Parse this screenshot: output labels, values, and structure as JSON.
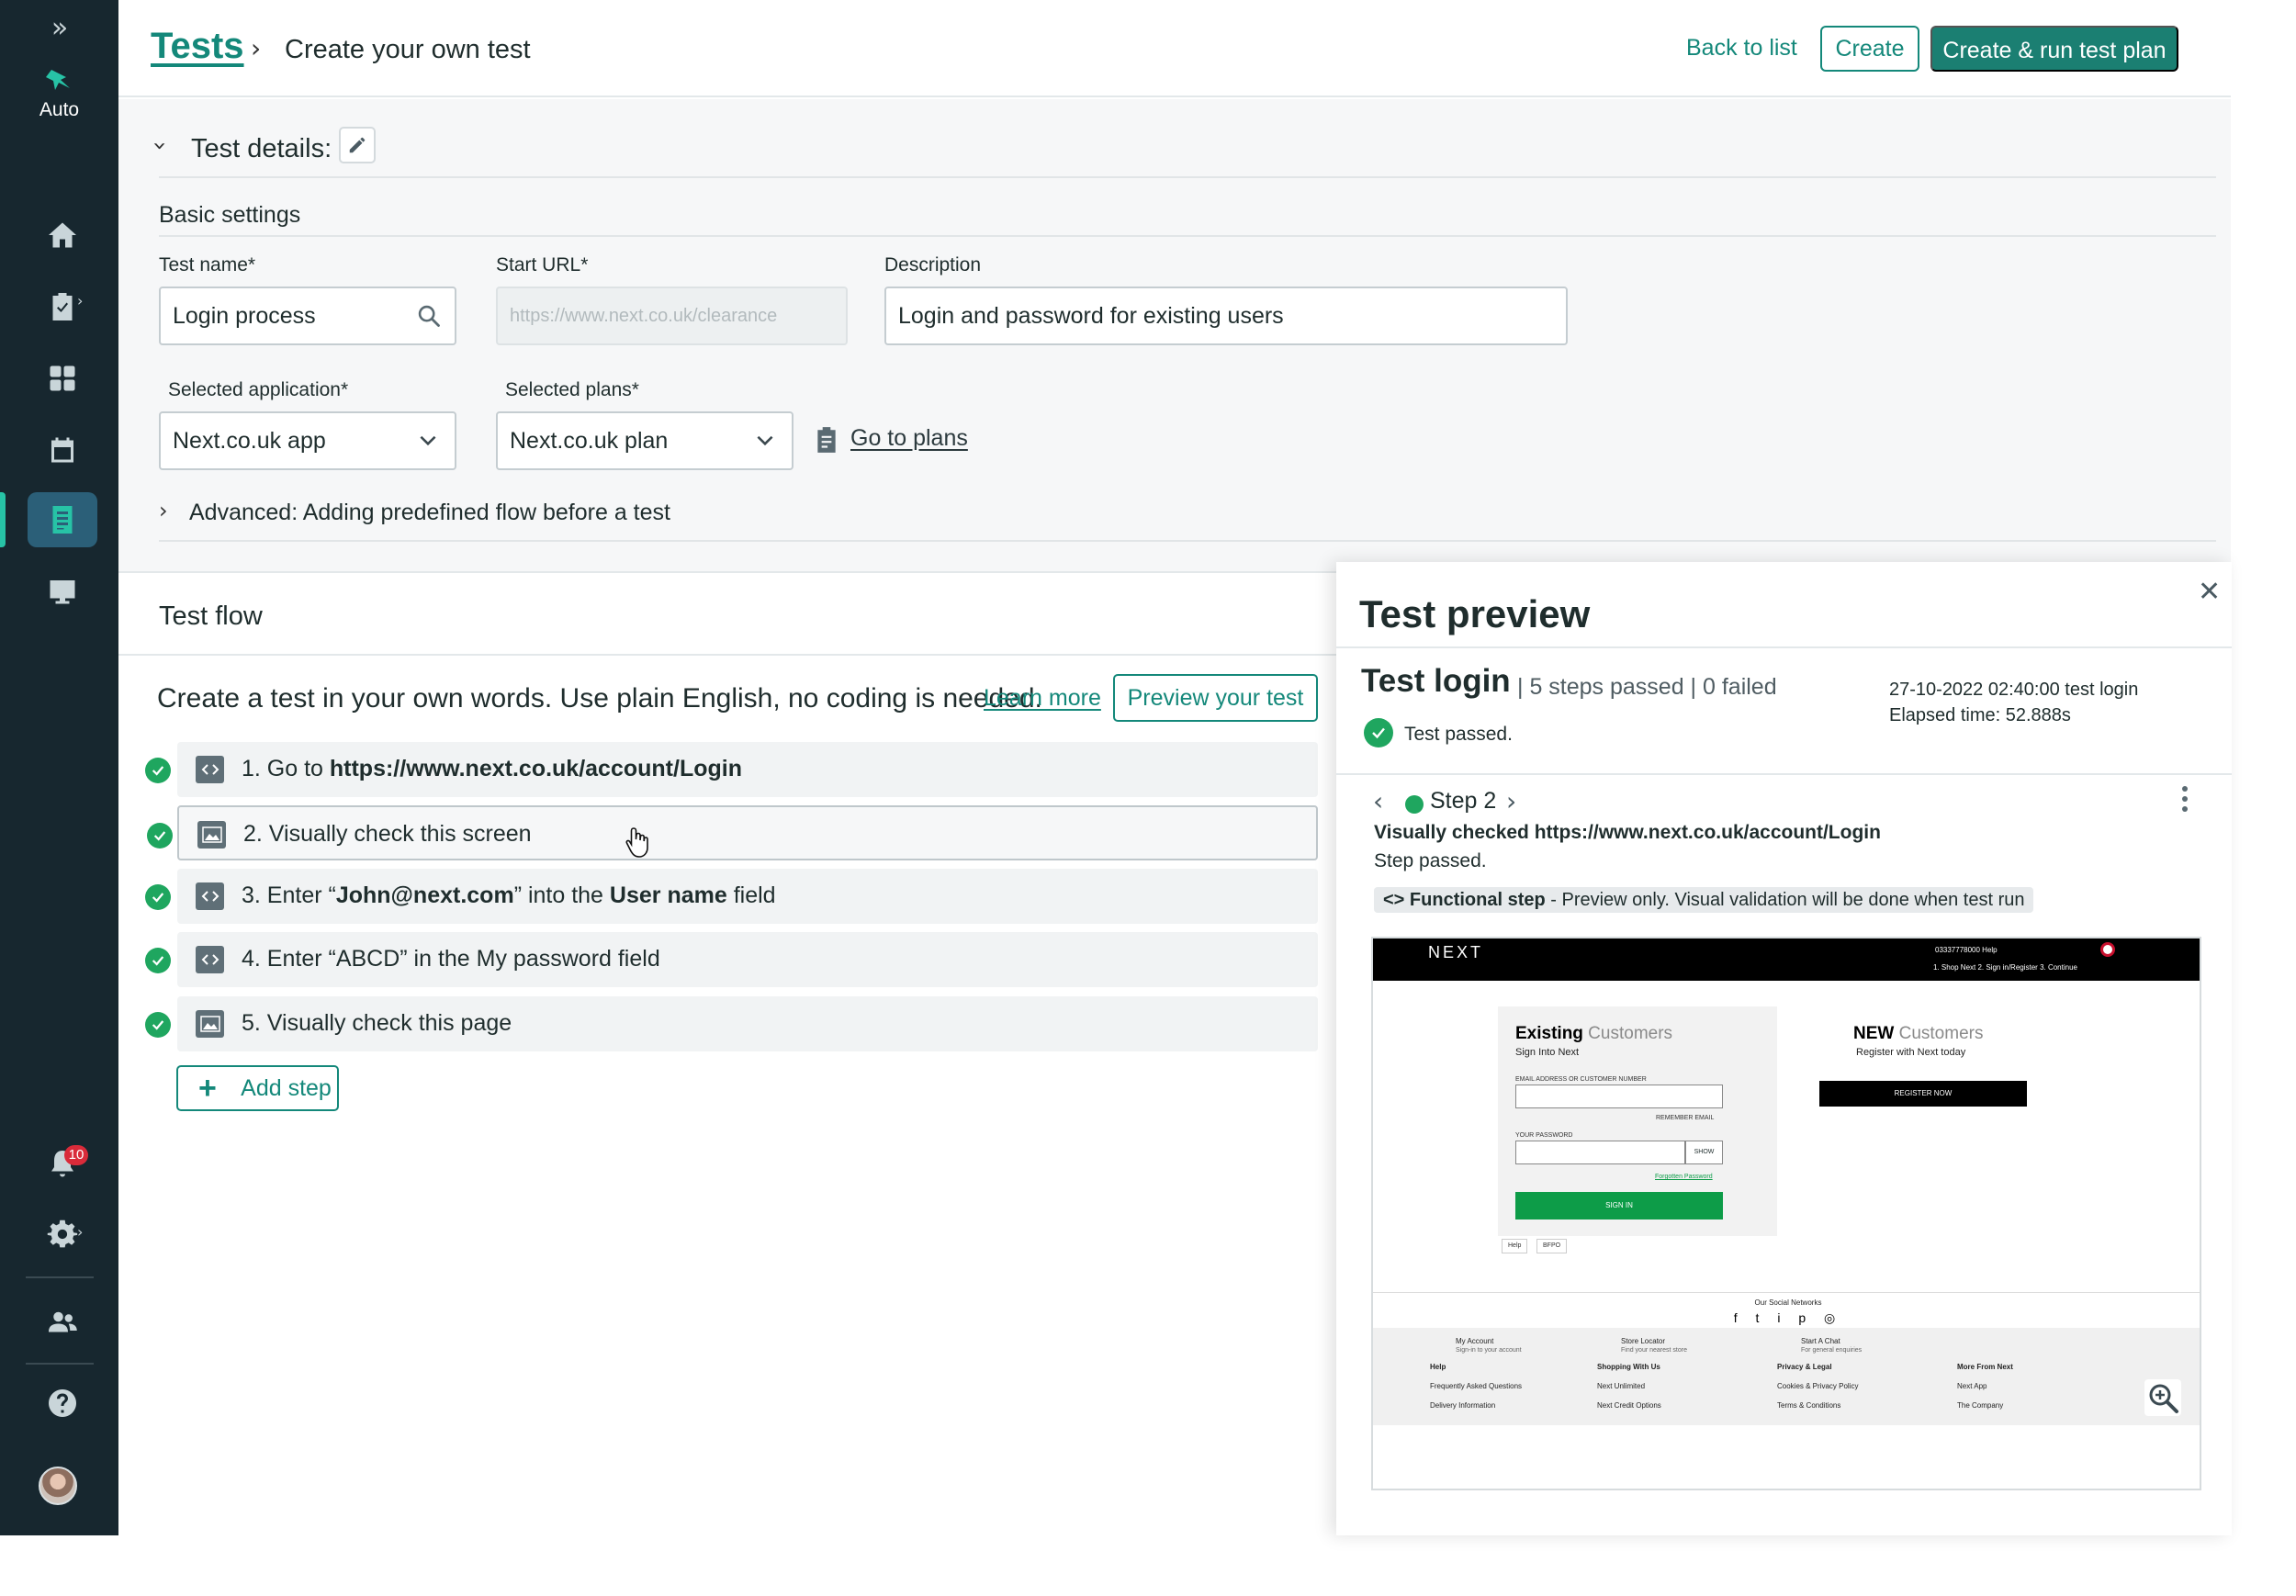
{
  "sidebar": {
    "expand_icon": "double-chevron-right-icon",
    "logo_label": "Auto",
    "items": [
      {
        "name": "home",
        "icon": "home-icon"
      },
      {
        "name": "clipboard",
        "icon": "clipboard-check-icon"
      },
      {
        "name": "dashboard",
        "icon": "grid-icon"
      },
      {
        "name": "calendar",
        "icon": "calendar-icon"
      },
      {
        "name": "tests",
        "icon": "document-list-icon",
        "active": true
      },
      {
        "name": "monitor",
        "icon": "monitor-icon"
      }
    ],
    "notifications_badge": "10",
    "accent": "#27c3a6"
  },
  "header": {
    "breadcrumb_root": "Tests",
    "breadcrumb_current": "Create your own test",
    "back_link": "Back to list",
    "create_label": "Create",
    "create_run_label": "Create & run test plan"
  },
  "details": {
    "title": "Test details:",
    "basic_settings": "Basic settings",
    "test_name_label": "Test name*",
    "test_name_value": "Login process",
    "start_url_label": "Start URL*",
    "start_url_placeholder": "https://www.next.co.uk/clearance",
    "description_label": "Description",
    "description_value": "Login and password for existing users",
    "app_label": "Selected application*",
    "app_value": "Next.co.uk app",
    "plans_label": "Selected plans*",
    "plans_value": "Next.co.uk plan",
    "go_to_plans": "Go to plans",
    "advanced": "Advanced: Adding predefined flow before a test"
  },
  "flow": {
    "title": "Test flow",
    "intro": "Create a test in your own words. Use plain English, no coding is needed.",
    "learn_more": "Learn more",
    "preview_button": "Preview your test",
    "add_step": "Add step",
    "steps": [
      {
        "pre": "1. Go to ",
        "bold": "https://www.next.co.uk/account/Login",
        "mid": "",
        "bold2": "",
        "post": "",
        "type": "code"
      },
      {
        "pre": "2. Visually check this screen",
        "bold": "",
        "mid": "",
        "bold2": "",
        "post": "",
        "type": "image"
      },
      {
        "pre": "3. Enter “",
        "bold": "John@next.com",
        "mid": "” into the ",
        "bold2": "User name",
        "post": " field",
        "type": "code"
      },
      {
        "pre": "4. Enter “ABCD” in the My password field",
        "bold": "",
        "mid": "",
        "bold2": "",
        "post": "",
        "type": "code"
      },
      {
        "pre": "5. Visually check this page",
        "bold": "",
        "mid": "",
        "bold2": "",
        "post": "",
        "type": "image"
      }
    ]
  },
  "preview": {
    "title": "Test preview",
    "test_name": "Test login",
    "stats": "| 5 steps passed | 0 failed",
    "status": "Test passed.",
    "date": "27-10-2022 02:40:00  test login",
    "elapsed": "Elapsed time: 52.888s",
    "step_label": "Step 2",
    "checked_text": "Visually checked https://www.next.co.uk/account/Login",
    "step_status": "Step passed.",
    "tag_bold": "Functional step",
    "tag_rest": " - Preview only. Visual validation will be done when test run",
    "screenshot": {
      "logo": "NEXT",
      "top_links": "03337778000    Help",
      "sub_links": "1. Shop Next    2. Sign in/Register    3. Continue",
      "existing_a": "Existing",
      "existing_b": " Customers",
      "sign_into": "Sign Into Next",
      "email_label": "EMAIL ADDRESS OR CUSTOMER NUMBER",
      "remember": "REMEMBER EMAIL",
      "password_label": "YOUR PASSWORD",
      "show": "SHOW",
      "forgotten": "Forgotten Password",
      "sign_in": "SIGN IN",
      "help_chip": "Help",
      "bfpo_chip": "BFPO",
      "new_a": "NEW",
      "new_b": " Customers",
      "register_with": "Register with Next today",
      "register_now": "REGISTER NOW",
      "social": "Our Social Networks",
      "social_icons": "f t i p ◎",
      "my_account": "My Account",
      "my_account_sub": "Sign-in to your account",
      "store_locator": "Store Locator",
      "store_locator_sub": "Find your nearest store",
      "start_chat": "Start A Chat",
      "start_chat_sub": "For general enquiries",
      "col1_title": "Help",
      "col1_a": "Frequently Asked Questions",
      "col1_b": "Delivery Information",
      "col2_title": "Shopping With Us",
      "col2_a": "Next Unlimited",
      "col2_b": "Next Credit Options",
      "col3_title": "Privacy & Legal",
      "col3_a": "Cookies & Privacy Policy",
      "col3_b": "Terms & Conditions",
      "col4_title": "More From Next",
      "col4_a": "Next App",
      "col4_b": "The Company"
    }
  },
  "colors": {
    "brand_teal": "#14887a",
    "primary_button": "#1b7f72",
    "sidebar_bg": "#17272f",
    "success_green": "#1fa65f"
  }
}
